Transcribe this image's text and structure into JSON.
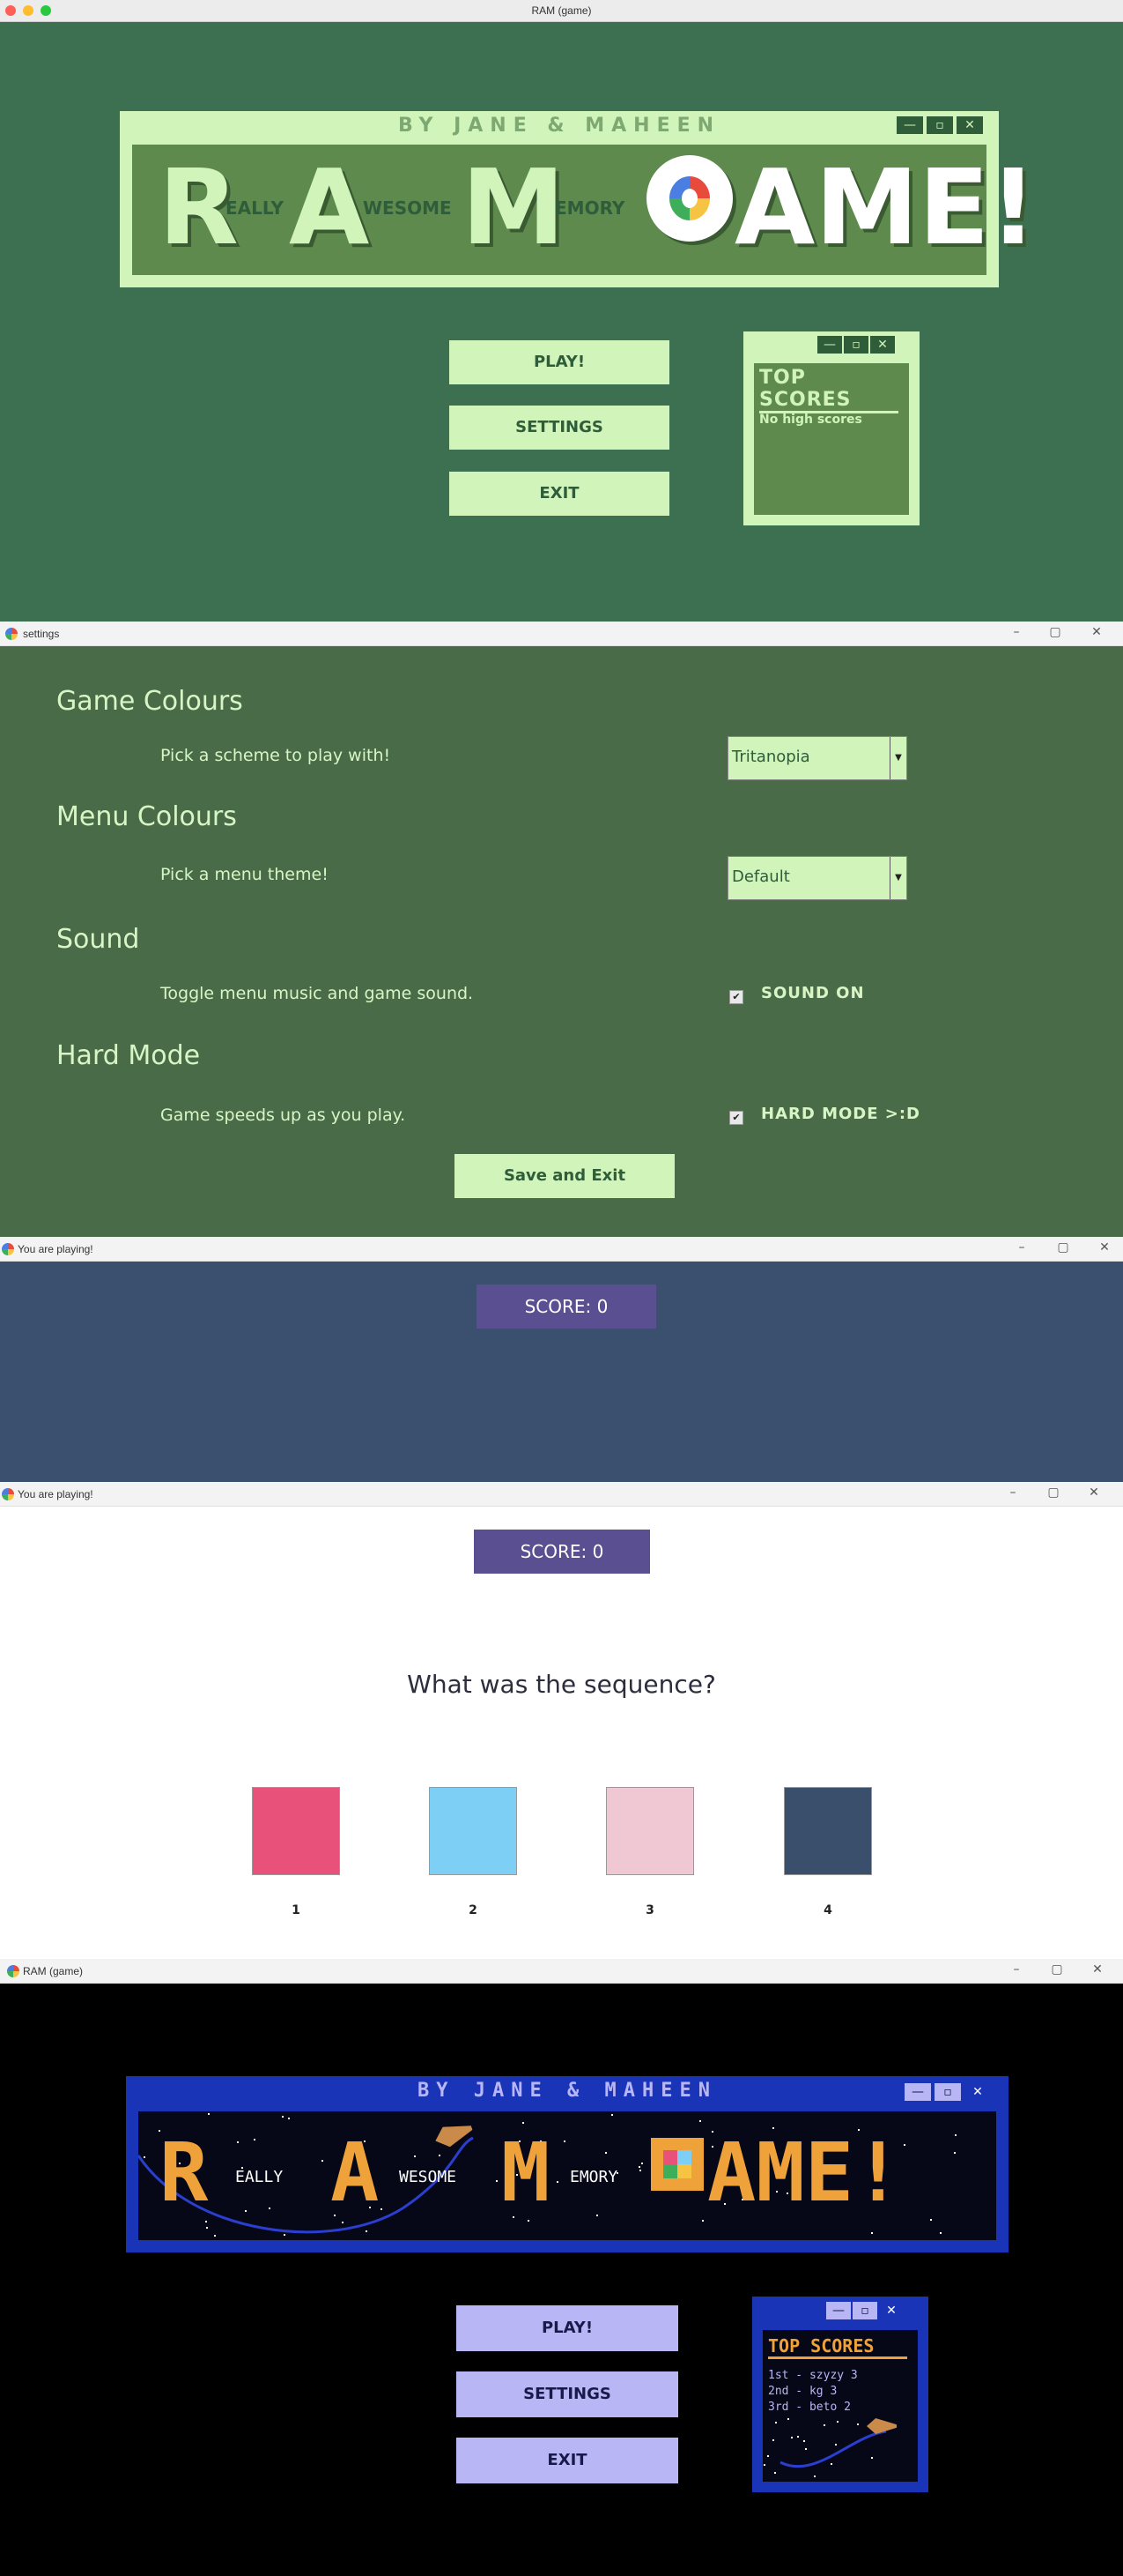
{
  "main_window": {
    "title": "RAM (game)",
    "byline": "BY JANE & MAHEEN",
    "logo": {
      "r": "R",
      "eally": "EALLY",
      "a": "A",
      "wesome": "WESOME",
      "m": "M",
      "emory": "EMORY",
      "game": "AME!"
    },
    "buttons": {
      "play": "PLAY!",
      "settings": "SETTINGS",
      "exit": "EXIT"
    },
    "scores": {
      "title": "TOP SCORES",
      "empty": "No high scores"
    },
    "window_controls": {
      "minimize": "—",
      "maximize": "▫",
      "close": "✕"
    }
  },
  "settings_window": {
    "title": "settings",
    "sections": {
      "game_colours": {
        "heading": "Game Colours",
        "desc": "Pick a scheme to play with!",
        "value": "Tritanopia"
      },
      "menu_colours": {
        "heading": "Menu Colours",
        "desc": "Pick a menu theme!",
        "value": "Default"
      },
      "sound": {
        "heading": "Sound",
        "desc": "Toggle menu music and game sound.",
        "checkbox_label": "SOUND ON",
        "checked": true
      },
      "hard_mode": {
        "heading": "Hard Mode",
        "desc": "Game speeds up as you play.",
        "checkbox_label": "HARD MODE >:D",
        "checked": true
      }
    },
    "save_button": "Save and Exit"
  },
  "play_window_1": {
    "title": "You are playing!",
    "score": "SCORE: 0"
  },
  "play_window_2": {
    "title": "You are playing!",
    "score": "SCORE: 0",
    "question": "What was the sequence?",
    "tiles": [
      {
        "label": "1",
        "color": "#e8527a"
      },
      {
        "label": "2",
        "color": "#7ecff5"
      },
      {
        "label": "3",
        "color": "#f0c8d4"
      },
      {
        "label": "4",
        "color": "#3a4f6c"
      }
    ]
  },
  "space_window": {
    "title": "RAM (game)",
    "byline": "BY JANE & MAHEEN",
    "logo": {
      "r": "R",
      "eally": "EALLY",
      "a": "A",
      "wesome": "WESOME",
      "m": "M",
      "emory": "EMORY",
      "game": "AME!"
    },
    "buttons": {
      "play": "PLAY!",
      "settings": "SETTINGS",
      "exit": "EXIT"
    },
    "scores": {
      "title": "TOP SCORES",
      "entries": [
        "1st - szyzy 3",
        "2nd - kg 3",
        "3rd - beto 2"
      ]
    }
  },
  "colors": {
    "green_bg": "#3d7050",
    "settings_bg": "#4a6b48",
    "navy_bg": "#3b4f6e",
    "mint": "#d0f4ba",
    "score_purple": "#5a4f91",
    "space_blue": "#1a34b8",
    "space_orange": "#f0a23a",
    "lavender": "#b9b6f6"
  }
}
